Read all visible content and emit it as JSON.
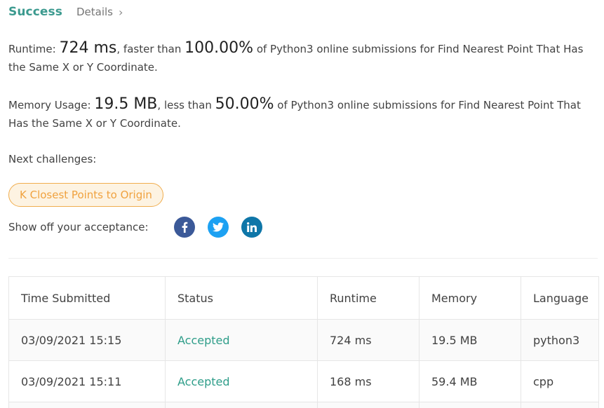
{
  "header": {
    "status": "Success",
    "details_link": "Details"
  },
  "result": {
    "runtime_label": "Runtime:",
    "runtime_value": "724 ms",
    "runtime_mid": ", faster than",
    "runtime_percent": "100.00%",
    "runtime_tail": "of Python3 online submissions for Find Nearest Point That Has the Same X or Y Coordinate.",
    "memory_label": "Memory Usage:",
    "memory_value": "19.5 MB",
    "memory_mid": ", less than",
    "memory_percent": "50.00%",
    "memory_tail": "of Python3 online submissions for Find Nearest Point That Has the Same X or Y Coordinate."
  },
  "next": {
    "label": "Next challenges:",
    "challenge": "K Closest Points to Origin"
  },
  "share": {
    "label": "Show off your acceptance:",
    "icons": [
      "facebook-icon",
      "twitter-icon",
      "linkedin-icon"
    ]
  },
  "colors": {
    "success": "#3c9a8f",
    "accepted": "#2e9d89",
    "chip_border": "#f0ad4e",
    "chip_text": "#f0a23f"
  },
  "table": {
    "headers": [
      "Time Submitted",
      "Status",
      "Runtime",
      "Memory",
      "Language"
    ],
    "rows": [
      [
        "03/09/2021 15:15",
        "Accepted",
        "724 ms",
        "19.5 MB",
        "python3"
      ],
      [
        "03/09/2021 15:11",
        "Accepted",
        "168 ms",
        "59.4 MB",
        "cpp"
      ]
    ]
  }
}
